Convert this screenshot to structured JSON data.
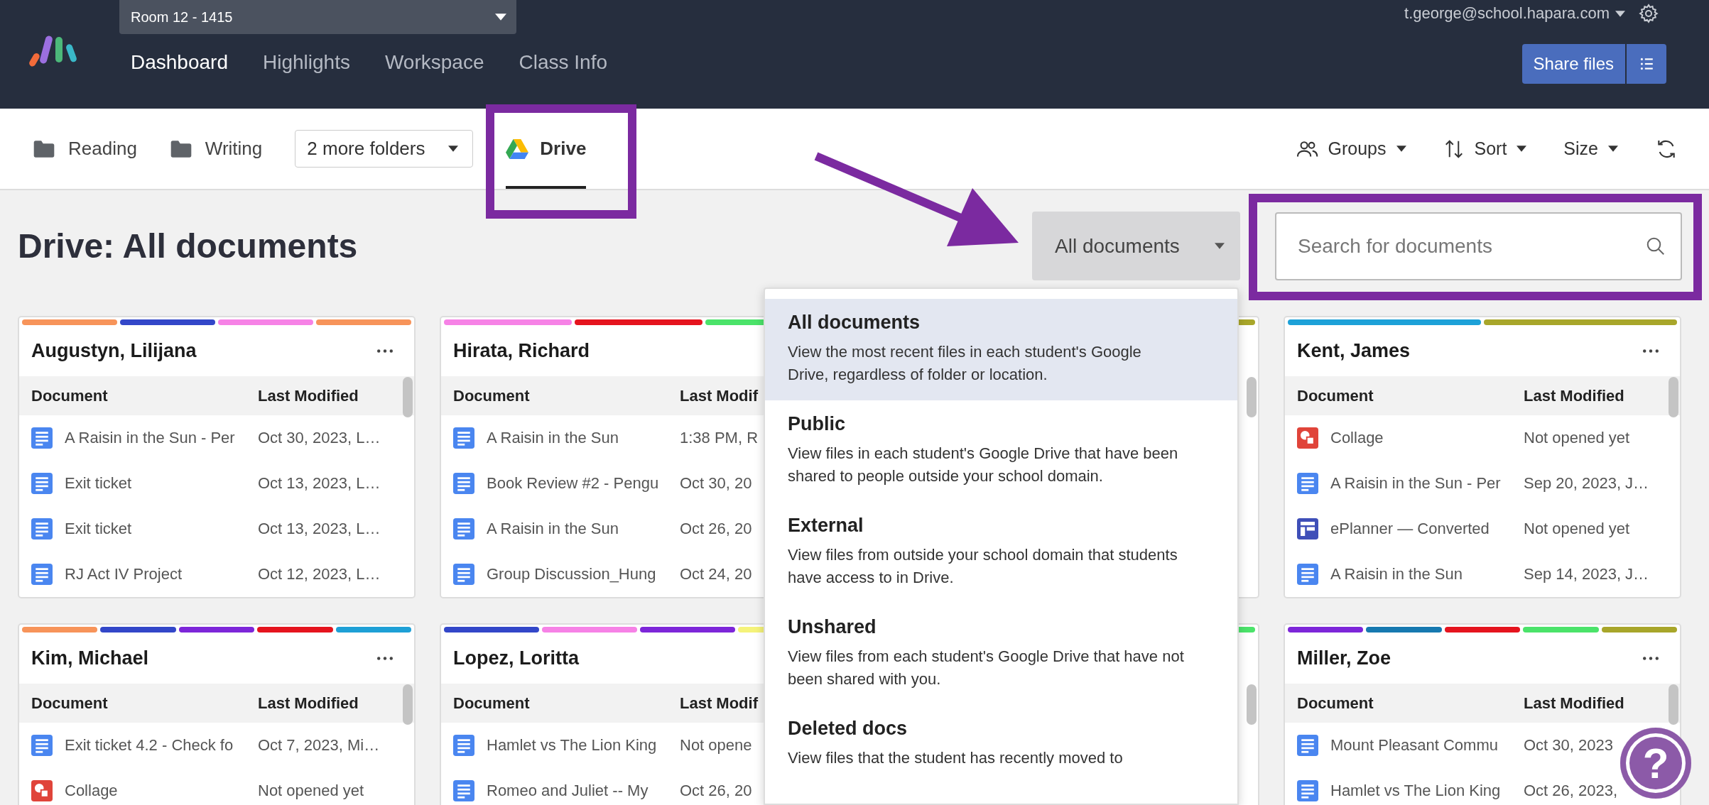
{
  "header": {
    "room_select": "Room 12 - 1415",
    "nav": [
      {
        "label": "Dashboard",
        "selected": true
      },
      {
        "label": "Highlights",
        "selected": false
      },
      {
        "label": "Workspace",
        "selected": false
      },
      {
        "label": "Class Info",
        "selected": false
      }
    ],
    "account": "t.george@school.hapara.com",
    "share_button": "Share files"
  },
  "toolbar": {
    "folders": [
      {
        "label": "Reading",
        "selected": false
      },
      {
        "label": "Writing",
        "selected": false
      }
    ],
    "more_folders": "2 more folders",
    "drive_tab": {
      "label": "Drive",
      "selected": true
    },
    "tools": [
      {
        "kind": "groups",
        "label": "Groups"
      },
      {
        "kind": "sort",
        "label": "Sort"
      },
      {
        "kind": "size",
        "label": "Size"
      },
      {
        "kind": "refresh"
      }
    ]
  },
  "page_title": "Drive: All documents",
  "filter": {
    "label": "All documents"
  },
  "search": {
    "placeholder": "Search for documents"
  },
  "filter_menu": [
    {
      "title": "All documents",
      "description": "View the most recent files in each student's Google Drive, regardless of folder or location.",
      "selected": true
    },
    {
      "title": "Public",
      "description": "View files in each student's Google Drive that have been shared to people outside your school domain.",
      "selected": false
    },
    {
      "title": "External",
      "description": "View files from outside your school domain that students have access to in Drive.",
      "selected": false
    },
    {
      "title": "Unshared",
      "description": "View files from each student's Google Drive that have not been shared with you.",
      "selected": false
    },
    {
      "title": "Deleted docs",
      "description": "View files that the student has recently moved to",
      "selected": false
    }
  ],
  "cards": [
    {
      "name": "Augustyn, Lilijana",
      "groups": [
        {
          "color": "#f7945a"
        },
        {
          "color": "#3347c9"
        },
        {
          "color": "#f682e6"
        },
        {
          "color": "#f7945a"
        }
      ],
      "columns": [
        "Document",
        "Last Modified"
      ],
      "rows": [
        {
          "kind": "doc",
          "document": "A Raisin in the Sun - Per",
          "modified": "Oct 30, 2023, L…"
        },
        {
          "kind": "doc",
          "document": "Exit ticket",
          "modified": "Oct 13, 2023, L…"
        },
        {
          "kind": "doc",
          "document": "Exit ticket",
          "modified": "Oct 13, 2023, L…"
        },
        {
          "kind": "doc",
          "document": "RJ Act IV Project",
          "modified": "Oct 12, 2023, L…"
        }
      ]
    },
    {
      "name": "Hirata, Richard",
      "groups": [
        {
          "color": "#f682e6"
        },
        {
          "color": "#e5141e"
        },
        {
          "color": "#4be36a"
        }
      ],
      "columns": [
        "Document",
        "Last Modif"
      ],
      "rows": [
        {
          "kind": "doc",
          "document": "A Raisin in the Sun",
          "modified": "1:38 PM, R"
        },
        {
          "kind": "doc",
          "document": "Book Review #2 - Pengu",
          "modified": "Oct 30, 20"
        },
        {
          "kind": "doc",
          "document": "A Raisin in the Sun",
          "modified": "Oct 26, 20"
        },
        {
          "kind": "doc",
          "document": "Group Discussion_Hung",
          "modified": "Oct 24, 20"
        }
      ]
    },
    {
      "groups": [
        {
          "color": "#a8a62a"
        }
      ]
    },
    {
      "name": "Kent, James",
      "groups": [
        {
          "color": "#1da1d8"
        },
        {
          "color": "#a8a62a"
        }
      ],
      "columns": [
        "Document",
        "Last Modified"
      ],
      "rows": [
        {
          "kind": "collage",
          "document": "Collage",
          "modified": "Not opened yet"
        },
        {
          "kind": "doc",
          "document": "A Raisin in the Sun - Per",
          "modified": "Sep 20, 2023, J…"
        },
        {
          "kind": "planner",
          "document": "ePlanner — Converted",
          "modified": "Not opened yet"
        },
        {
          "kind": "doc",
          "document": "A Raisin in the Sun",
          "modified": "Sep 14, 2023, J…"
        }
      ]
    },
    {
      "name": "Kim, Michael",
      "groups": [
        {
          "color": "#f7945a"
        },
        {
          "color": "#3347c9"
        },
        {
          "color": "#7d26d9"
        },
        {
          "color": "#e5141e"
        },
        {
          "color": "#1ea0d6"
        }
      ],
      "columns": [
        "Document",
        "Last Modified"
      ],
      "rows": [
        {
          "kind": "doc",
          "document": "Exit ticket 4.2 - Check fo",
          "modified": "Oct 7, 2023, Mi…"
        },
        {
          "kind": "collage",
          "document": "Collage",
          "modified": "Not opened yet"
        }
      ]
    },
    {
      "name": "Lopez, Loritta",
      "groups": [
        {
          "color": "#3347c9"
        },
        {
          "color": "#f682e6"
        },
        {
          "color": "#7d26d9"
        },
        {
          "color": "#f5f37a"
        }
      ],
      "columns": [
        "Document",
        "Last Modif"
      ],
      "rows": [
        {
          "kind": "doc",
          "document": "Hamlet vs The Lion King",
          "modified": "Not opene"
        },
        {
          "kind": "doc",
          "document": "Romeo and Juliet -- My",
          "modified": "Oct 26, 20"
        }
      ]
    },
    {
      "groups": [
        {
          "color": "#4be36a"
        }
      ]
    },
    {
      "name": "Miller, Zoe",
      "groups": [
        {
          "color": "#7d26d9"
        },
        {
          "color": "#1679b0"
        },
        {
          "color": "#e5141e"
        },
        {
          "color": "#4be36a"
        },
        {
          "color": "#a8a62a"
        }
      ],
      "columns": [
        "Document",
        "Last Modified"
      ],
      "rows": [
        {
          "kind": "doc",
          "document": "Mount Pleasant Commu",
          "modified": "Oct 30, 2023"
        },
        {
          "kind": "doc",
          "document": "Hamlet vs The Lion King",
          "modified": "Oct 26, 2023,"
        }
      ]
    }
  ],
  "help_button": "?"
}
